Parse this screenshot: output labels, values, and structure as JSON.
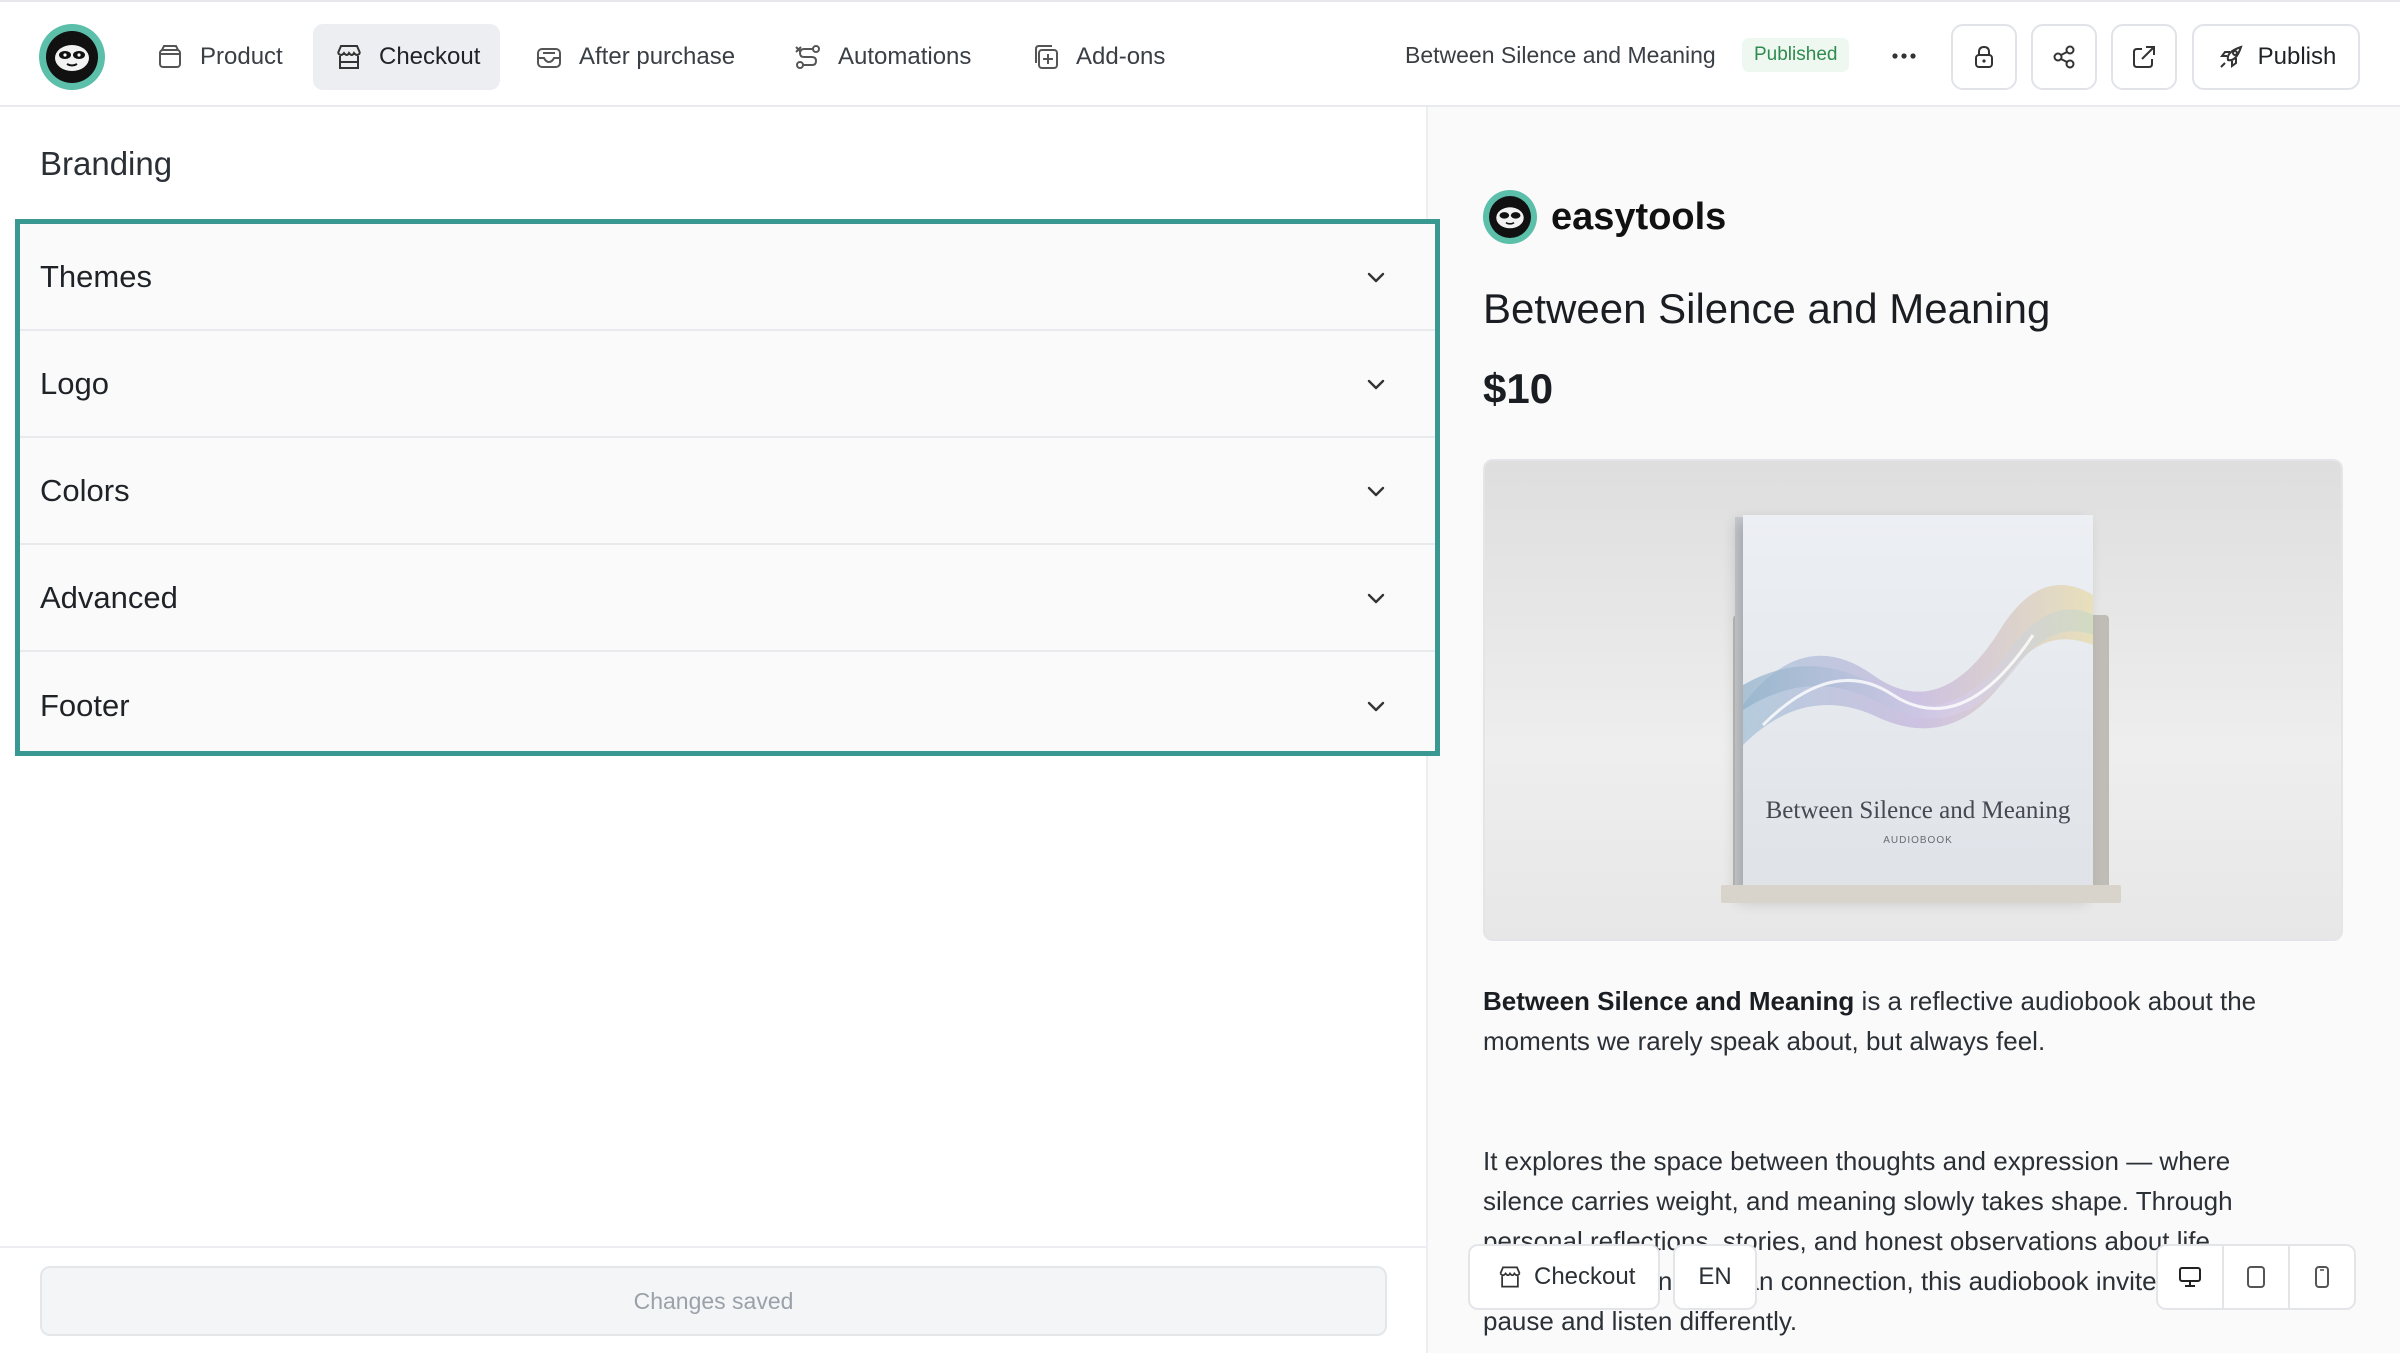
{
  "nav": {
    "items": [
      {
        "label": "Product",
        "icon": "box-icon",
        "active": false
      },
      {
        "label": "Checkout",
        "icon": "store-icon",
        "active": true
      },
      {
        "label": "After purchase",
        "icon": "inbox-icon",
        "active": false
      },
      {
        "label": "Automations",
        "icon": "route-icon",
        "active": false
      },
      {
        "label": "Add-ons",
        "icon": "plus-square-icon",
        "active": false
      }
    ],
    "doc_title": "Between Silence and Meaning",
    "status_badge": "Published",
    "publish_label": "Publish"
  },
  "left": {
    "section_title": "Branding",
    "accordion": [
      {
        "label": "Themes"
      },
      {
        "label": "Logo"
      },
      {
        "label": "Colors"
      },
      {
        "label": "Advanced"
      },
      {
        "label": "Footer"
      }
    ],
    "save_status": "Changes saved"
  },
  "preview": {
    "brand_name": "easytools",
    "product_title": "Between Silence and Meaning",
    "price": "$10",
    "cover_title": "Between Silence and Meaning",
    "cover_subtitle": "AUDIOBOOK",
    "desc_bold": "Between Silence and Meaning",
    "desc_rest": " is a reflective audiobook about the moments we rarely speak about, but always feel.",
    "desc2_line1": "It explores the space between thoughts and expression — where",
    "desc2_line2": "silence carries weight, and meaning slowly takes shape. Through",
    "desc2_line3": "personal reflections, stories, and honest observations about life,",
    "desc2_line4": "relationships, and human connection, this audiobook invites you to",
    "desc2_line5": "pause and listen differently.",
    "float_checkout": "Checkout",
    "float_lang": "EN"
  },
  "colors": {
    "accent_teal": "#3a9893",
    "brand_green": "#5bbfaa",
    "published_green": "#2e8b4f"
  }
}
